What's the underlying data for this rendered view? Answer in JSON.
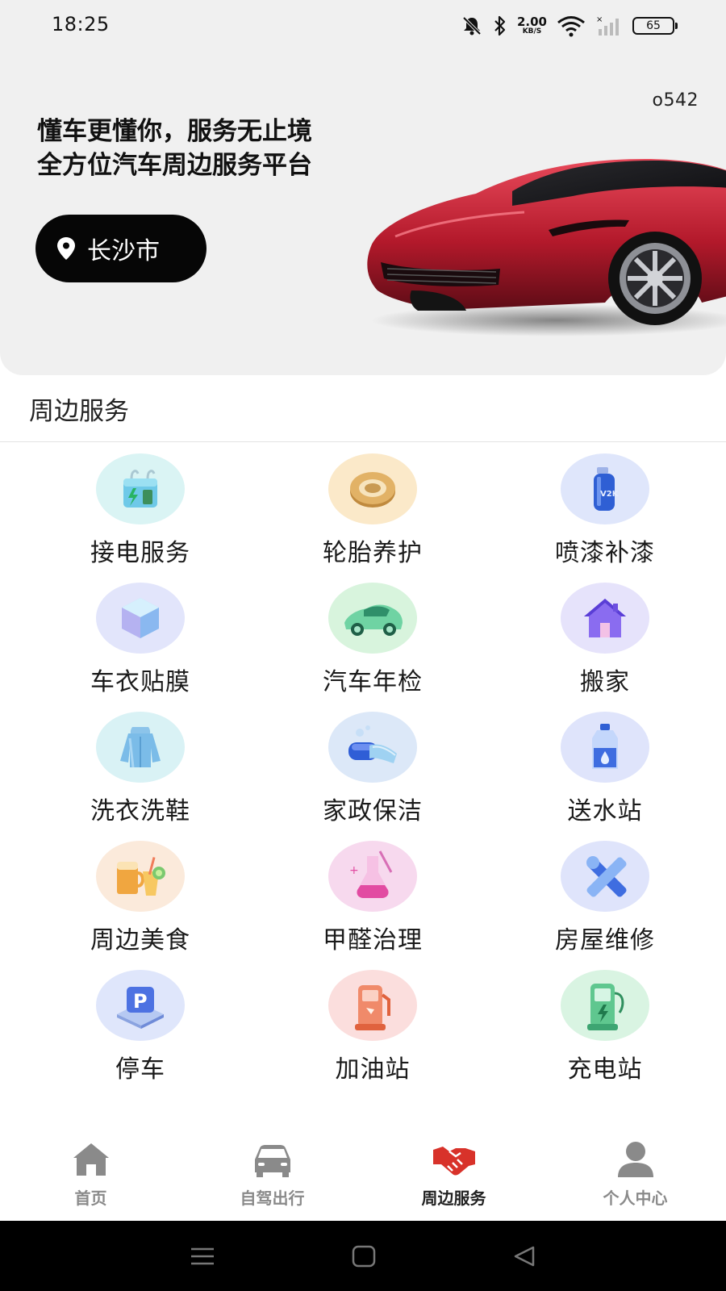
{
  "status_bar": {
    "time": "18:25",
    "net_speed": "2.00",
    "net_unit": "KB/S",
    "battery": "65"
  },
  "hero": {
    "corner_code": "o542",
    "slogan_line1": "懂车更懂你，服务无止境",
    "slogan_line2": "全方位汽车周边服务平台",
    "city": "长沙市"
  },
  "section": {
    "title": "周边服务"
  },
  "services": [
    {
      "label": "接电服务",
      "icon": "jump-start-icon"
    },
    {
      "label": "轮胎养护",
      "icon": "tire-icon"
    },
    {
      "label": "喷漆补漆",
      "icon": "spray-paint-icon"
    },
    {
      "label": "车衣贴膜",
      "icon": "car-film-icon"
    },
    {
      "label": "汽车年检",
      "icon": "annual-inspection-icon"
    },
    {
      "label": "搬家",
      "icon": "moving-house-icon"
    },
    {
      "label": "洗衣洗鞋",
      "icon": "laundry-icon"
    },
    {
      "label": "家政保洁",
      "icon": "cleaning-icon"
    },
    {
      "label": "送水站",
      "icon": "water-delivery-icon"
    },
    {
      "label": "周边美食",
      "icon": "food-icon"
    },
    {
      "label": "甲醛治理",
      "icon": "formaldehyde-icon"
    },
    {
      "label": "房屋维修",
      "icon": "house-repair-icon"
    },
    {
      "label": "停车",
      "icon": "parking-icon"
    },
    {
      "label": "加油站",
      "icon": "gas-station-icon"
    },
    {
      "label": "充电站",
      "icon": "charging-station-icon"
    }
  ],
  "tabs": [
    {
      "label": "首页",
      "icon": "home-icon",
      "active": false
    },
    {
      "label": "自驾出行",
      "icon": "car-icon",
      "active": false
    },
    {
      "label": "周边服务",
      "icon": "handshake-icon",
      "active": true
    },
    {
      "label": "个人中心",
      "icon": "user-icon",
      "active": false
    }
  ],
  "colors": {
    "accent": "#d8322a",
    "tab_inactive": "#8a8a8a",
    "hero_bg": "#f0f0f0",
    "pill_bg": "#060606"
  }
}
